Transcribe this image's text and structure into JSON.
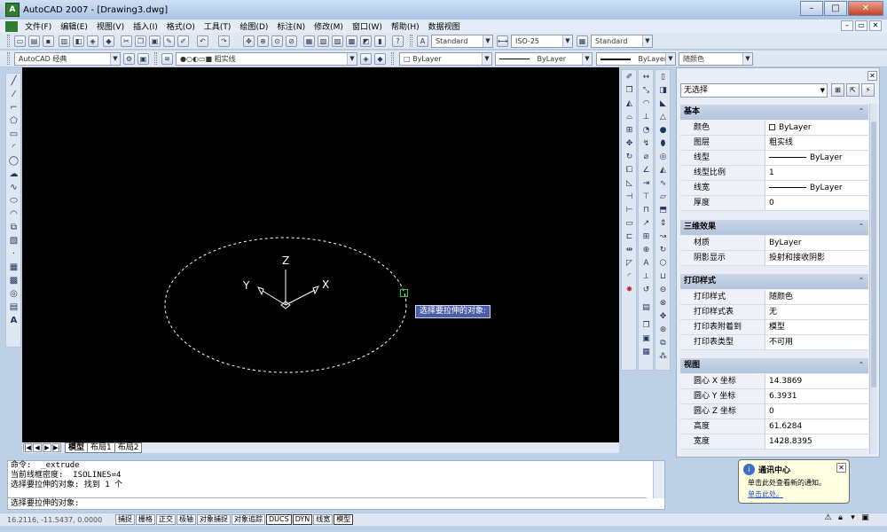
{
  "window": {
    "title": "AutoCAD 2007 - [Drawing3.dwg]",
    "controls": [
      "–",
      "□",
      "✕"
    ]
  },
  "menu": {
    "items": [
      "文件(F)",
      "编辑(E)",
      "视图(V)",
      "插入(I)",
      "格式(O)",
      "工具(T)",
      "绘图(D)",
      "标注(N)",
      "修改(M)",
      "窗口(W)",
      "帮助(H)",
      "数据视图"
    ],
    "mdi_controls": [
      "–",
      "▭",
      "✕"
    ]
  },
  "toolbar1": {
    "text_style": "Standard",
    "dim_style": "ISO-25",
    "table_style": "Standard"
  },
  "toolbar2": {
    "workspace": "AutoCAD 经典",
    "layer": "粗实线",
    "color": "ByLayer",
    "linetype": "ByLayer",
    "lineweight": "ByLayer",
    "plot_style": "随颜色"
  },
  "canvas": {
    "tooltip": "选择要拉伸的对象:",
    "ucs": {
      "z": "Z",
      "y": "Y",
      "x": "X"
    },
    "colors": {
      "background": "#000000",
      "ellipse": "#ffffff",
      "cursor": "#2ecc40"
    }
  },
  "layout_tabs": {
    "nav": [
      "|◀",
      "◀",
      "▶",
      "▶|"
    ],
    "tabs": [
      "模型",
      "布局1",
      "布局2"
    ]
  },
  "properties": {
    "selection": "无选择",
    "sections": [
      {
        "title": "基本",
        "rows": [
          {
            "name": "颜色",
            "value": "ByLayer"
          },
          {
            "name": "图层",
            "value": "粗实线"
          },
          {
            "name": "线型",
            "value": "ByLayer"
          },
          {
            "name": "线型比例",
            "value": "1"
          },
          {
            "name": "线宽",
            "value": "ByLayer"
          },
          {
            "name": "厚度",
            "value": "0"
          }
        ]
      },
      {
        "title": "三维效果",
        "rows": [
          {
            "name": "材质",
            "value": "ByLayer"
          },
          {
            "name": "阴影显示",
            "value": "投射和接收阴影"
          }
        ]
      },
      {
        "title": "打印样式",
        "rows": [
          {
            "name": "打印样式",
            "value": "随颜色"
          },
          {
            "name": "打印样式表",
            "value": "无"
          },
          {
            "name": "打印表附着到",
            "value": "模型"
          },
          {
            "name": "打印表类型",
            "value": "不可用"
          }
        ]
      },
      {
        "title": "视图",
        "rows": [
          {
            "name": "圆心 X 坐标",
            "value": "14.3869"
          },
          {
            "name": "圆心 Y 坐标",
            "value": "6.3931"
          },
          {
            "name": "圆心 Z 坐标",
            "value": "0"
          },
          {
            "name": "高度",
            "value": "61.6284"
          },
          {
            "name": "宽度",
            "value": "1428.8395"
          }
        ]
      }
    ]
  },
  "command": {
    "history": [
      "命令:  _extrude",
      "当前线框密度:  ISOLINES=4",
      "选择要拉伸的对象: 找到 1 个"
    ],
    "prompt": "选择要拉伸的对象:"
  },
  "status": {
    "coords": "16.2116, -11.5437, 0.0000",
    "toggles": [
      "捕捉",
      "栅格",
      "正交",
      "极轴",
      "对象捕捉",
      "对象追踪",
      "DUCS",
      "DYN",
      "线宽",
      "模型"
    ],
    "on": [
      "DUCS",
      "DYN",
      "模型"
    ]
  },
  "balloon": {
    "title": "通讯中心",
    "text": "单击此处查看新的通知。",
    "link": "单击此处。"
  }
}
